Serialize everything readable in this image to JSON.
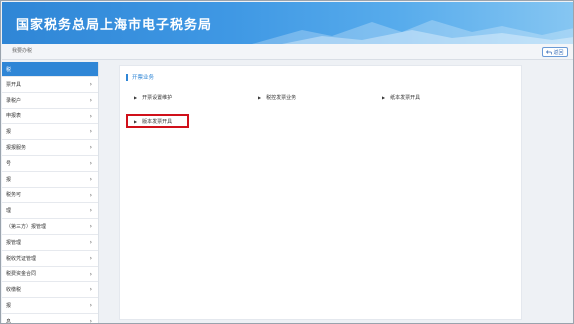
{
  "header": {
    "title": "国家税务总局上海市电子税务局"
  },
  "toolbar": {
    "breadcrumb": "我要办税",
    "back_label": "返回",
    "back_icon": "return-arrow-icon"
  },
  "sidebar": {
    "items": [
      {
        "label": "税",
        "active": true
      },
      {
        "label": "票开具",
        "active": false
      },
      {
        "label": "录税户",
        "active": false
      },
      {
        "label": "申报表",
        "active": false
      },
      {
        "label": "报",
        "active": false
      },
      {
        "label": "报报服务",
        "active": false
      },
      {
        "label": "号",
        "active": false
      },
      {
        "label": "报",
        "active": false
      },
      {
        "label": "税务可",
        "active": false
      },
      {
        "label": "理",
        "active": false
      },
      {
        "label": "（第三方）报管理",
        "active": false
      },
      {
        "label": "报管理",
        "active": false
      },
      {
        "label": "税收凭证管理",
        "active": false
      },
      {
        "label": "税费资金合同",
        "active": false
      },
      {
        "label": "收缴税",
        "active": false
      },
      {
        "label": "报",
        "active": false
      },
      {
        "label": "息",
        "active": false
      }
    ]
  },
  "main": {
    "section_title": "开票业务",
    "functions": [
      {
        "label": "开票设置维护"
      },
      {
        "label": "税控发票业务"
      },
      {
        "label": "纸本发票开具"
      },
      {
        "label": "版本发票开具"
      }
    ]
  },
  "colors": {
    "accent": "#2f86d6",
    "highlight": "#d0101a"
  }
}
